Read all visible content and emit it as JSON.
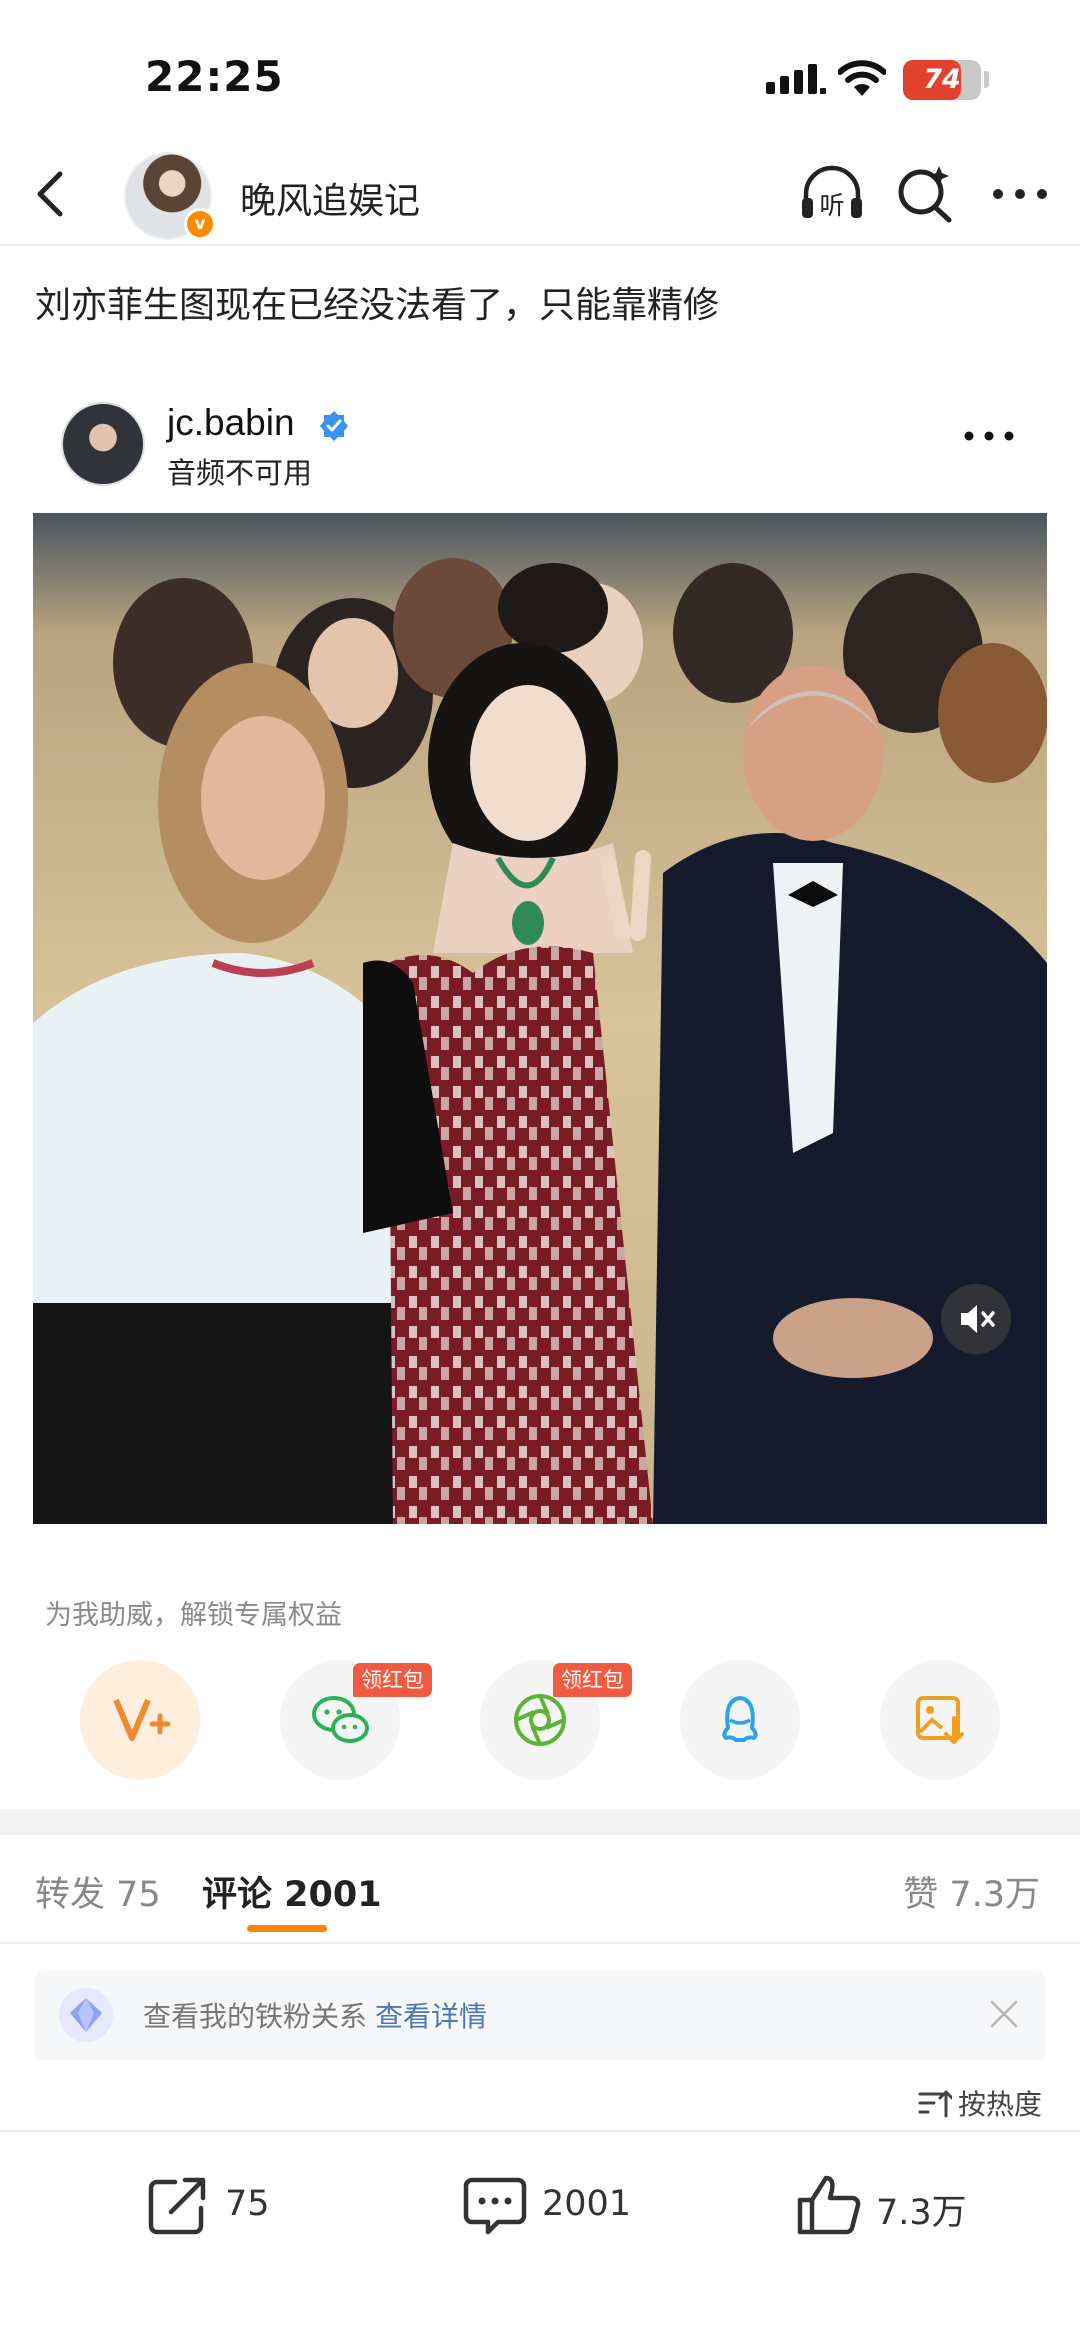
{
  "status_bar": {
    "time": "22:25",
    "battery": "74",
    "battery_level": 0.74
  },
  "nav": {
    "username": "晚风追娱记"
  },
  "post": {
    "text": "刘亦菲生图现在已经没法看了，只能靠精修"
  },
  "embed": {
    "username": "jc.babin",
    "subtitle": "音频不可用"
  },
  "share": {
    "promo_text": "为我助威，解锁专属权益",
    "badge": "领红包",
    "buttons": [
      {
        "icon": "vip-icon",
        "badge": false
      },
      {
        "icon": "wechat-icon",
        "badge": true
      },
      {
        "icon": "moments-icon",
        "badge": true
      },
      {
        "icon": "qq-icon",
        "badge": false
      },
      {
        "icon": "save-image-icon",
        "badge": false
      }
    ]
  },
  "tabs": {
    "repost": "转发 75",
    "comments": "评论 2001",
    "likes": "赞 7.3万",
    "active": "comments"
  },
  "fan_notice": {
    "text": "查看我的铁粉关系",
    "link": "查看详情"
  },
  "sort": {
    "label": "按热度"
  },
  "actions": {
    "repost_count": "75",
    "comment_count": "2001",
    "like_count": "7.3万"
  },
  "colors": {
    "accent": "#ff8200",
    "link": "#4a78b5",
    "badge": "#f05a40",
    "battery": "#e2422d"
  }
}
